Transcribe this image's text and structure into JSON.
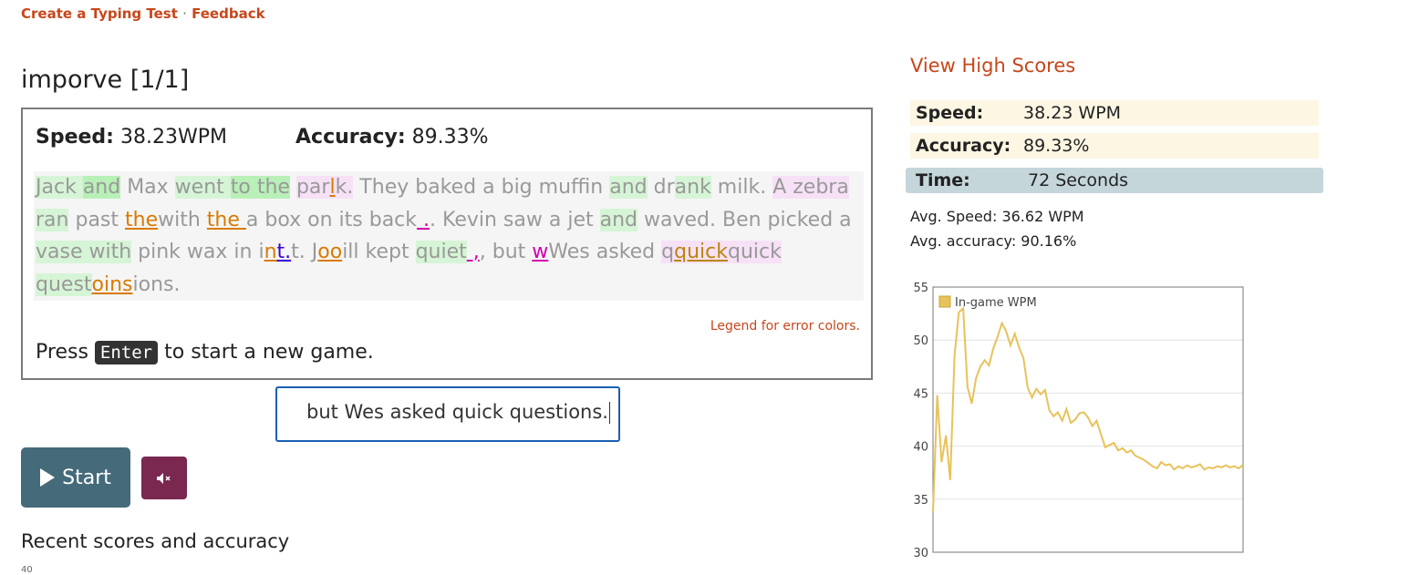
{
  "links": {
    "create": "Create a Typing Test",
    "sep": "·",
    "feedback": "Feedback"
  },
  "game": {
    "title": "imporve [1/1]",
    "speed_label": "Speed:",
    "speed_value": "38.23WPM",
    "accuracy_label": "Accuracy:",
    "accuracy_value": "89.33%",
    "legend_link": "Legend for error colors.",
    "press_before": "Press",
    "press_key": "Enter",
    "press_after": "to start a new game."
  },
  "input": {
    "value": "but Wes asked quick questions."
  },
  "buttons": {
    "start": "Start",
    "mute_icon": "mute-icon"
  },
  "recent": {
    "heading": "Recent scores and accuracy",
    "tick": "40"
  },
  "sidebar": {
    "high_scores": "View High Scores",
    "speed_label": "Speed:",
    "speed_value": "38.23 WPM",
    "accuracy_label": "Accuracy:",
    "accuracy_value": "89.33%",
    "time_label": "Time:",
    "time_value": "72 Seconds",
    "avg_speed": "Avg. Speed: 36.62 WPM",
    "avg_accuracy": "Avg. accuracy: 90.16%"
  },
  "colors": {
    "accent": "#c8461a",
    "start_button": "#456a7a",
    "mute_button": "#7a2850",
    "line": "#e8c25a"
  },
  "chart_data": {
    "type": "line",
    "series": [
      {
        "name": "In-game WPM",
        "x": [
          0,
          1,
          2,
          3,
          4,
          5,
          6,
          7,
          8,
          9,
          10,
          11,
          12,
          13,
          14,
          15,
          16,
          17,
          18,
          19,
          20,
          21,
          22,
          23,
          24,
          25,
          26,
          27,
          28,
          29,
          30,
          31,
          32,
          33,
          34,
          35,
          36,
          37,
          38,
          39,
          40,
          41,
          42,
          43,
          44,
          45,
          46,
          47,
          48,
          49,
          50,
          51,
          52,
          53,
          54,
          55,
          56,
          57,
          58,
          59,
          60,
          61,
          62,
          63,
          64,
          65,
          66,
          67,
          68,
          69,
          70,
          71,
          72
        ],
        "values": [
          33.8,
          44.8,
          38.5,
          41,
          36.8,
          48.5,
          52.6,
          53,
          45.6,
          44,
          46.4,
          47.5,
          48.1,
          47.6,
          49.2,
          50.3,
          51.6,
          50.8,
          49.5,
          50.6,
          49.3,
          48.3,
          45.5,
          44.6,
          45.4,
          44.9,
          45.3,
          43.4,
          42.8,
          43.2,
          42.4,
          43.5,
          42.2,
          42.5,
          43.1,
          43.2,
          42.7,
          41.9,
          42.4,
          41.1,
          39.9,
          40.1,
          40.3,
          39.6,
          39.8,
          39.4,
          39.6,
          39.1,
          38.9,
          38.7,
          38.4,
          38.1,
          37.9,
          38.5,
          38.2,
          38.3,
          37.8,
          38.1,
          37.9,
          38.2,
          38.0,
          38.1,
          38.3,
          37.8,
          38.0,
          37.9,
          38.1,
          38.0,
          38.2,
          38.0,
          38.1,
          37.9,
          38.23
        ]
      }
    ],
    "ylim": [
      30,
      55
    ],
    "yticks": [
      "55",
      "50",
      "45",
      "40",
      "35",
      "30"
    ],
    "legend": "top-left",
    "grid": true
  }
}
